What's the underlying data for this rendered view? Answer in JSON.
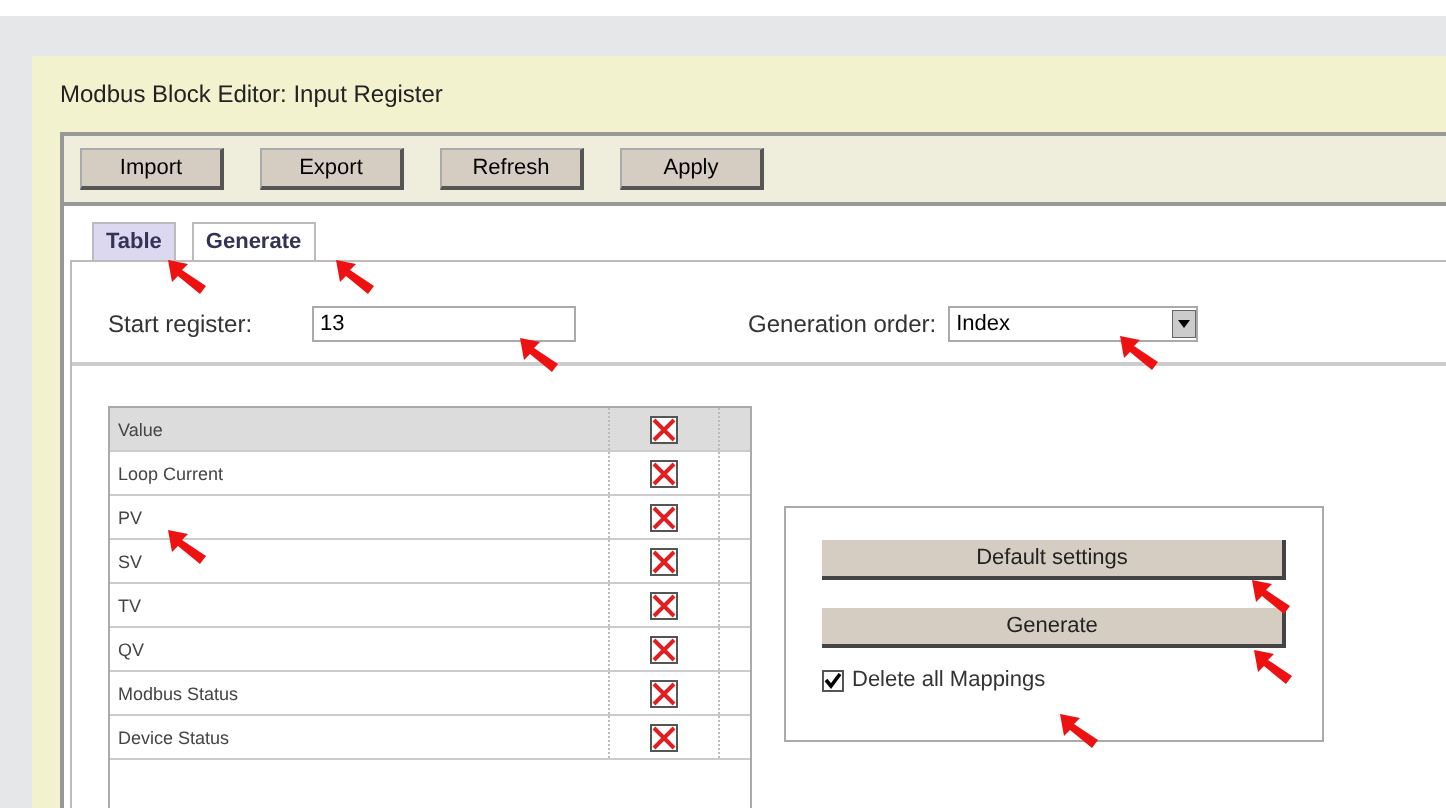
{
  "window": {
    "title": "Modbus Block Editor: Input Register"
  },
  "toolbar": [
    "Import",
    "Export",
    "Refresh",
    "Apply"
  ],
  "tabs": [
    {
      "label": "Table",
      "selected": false
    },
    {
      "label": "Generate",
      "selected": true
    }
  ],
  "start_register": {
    "label": "Start register:",
    "value": "13"
  },
  "generation_order": {
    "label": "Generation order:",
    "value": "Index"
  },
  "table": {
    "header": {
      "label": "Value",
      "checked": true
    },
    "rows": [
      {
        "label": "Loop Current",
        "checked": true
      },
      {
        "label": "PV",
        "checked": true
      },
      {
        "label": "SV",
        "checked": true
      },
      {
        "label": "TV",
        "checked": true
      },
      {
        "label": "QV",
        "checked": true
      },
      {
        "label": "Modbus Status",
        "checked": true
      },
      {
        "label": "Device Status",
        "checked": true
      }
    ]
  },
  "actions": [
    "Default settings",
    "Generate"
  ],
  "delete_all": {
    "label": "Delete all Mappings",
    "checked": true
  }
}
